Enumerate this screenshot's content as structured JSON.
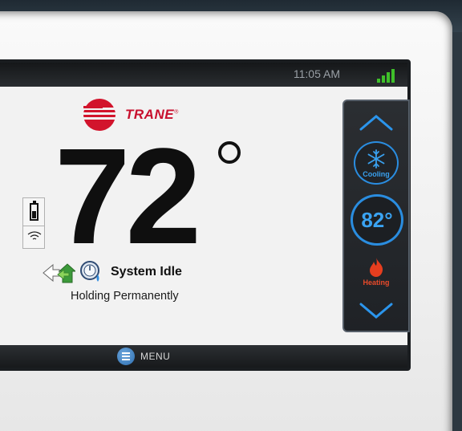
{
  "status_bar": {
    "time": "11:05 AM"
  },
  "brand": {
    "name": "TRANE",
    "trademark": "®",
    "color": "#c8102e"
  },
  "temperature": {
    "current": "72"
  },
  "status": {
    "system": "System Idle",
    "hold": "Holding Permanently"
  },
  "controls": {
    "cooling_label": "Cooling",
    "setpoint": "82°",
    "heating_label": "Heating",
    "accent_color": "#2a8de0"
  },
  "menu": {
    "label": "MENU"
  }
}
